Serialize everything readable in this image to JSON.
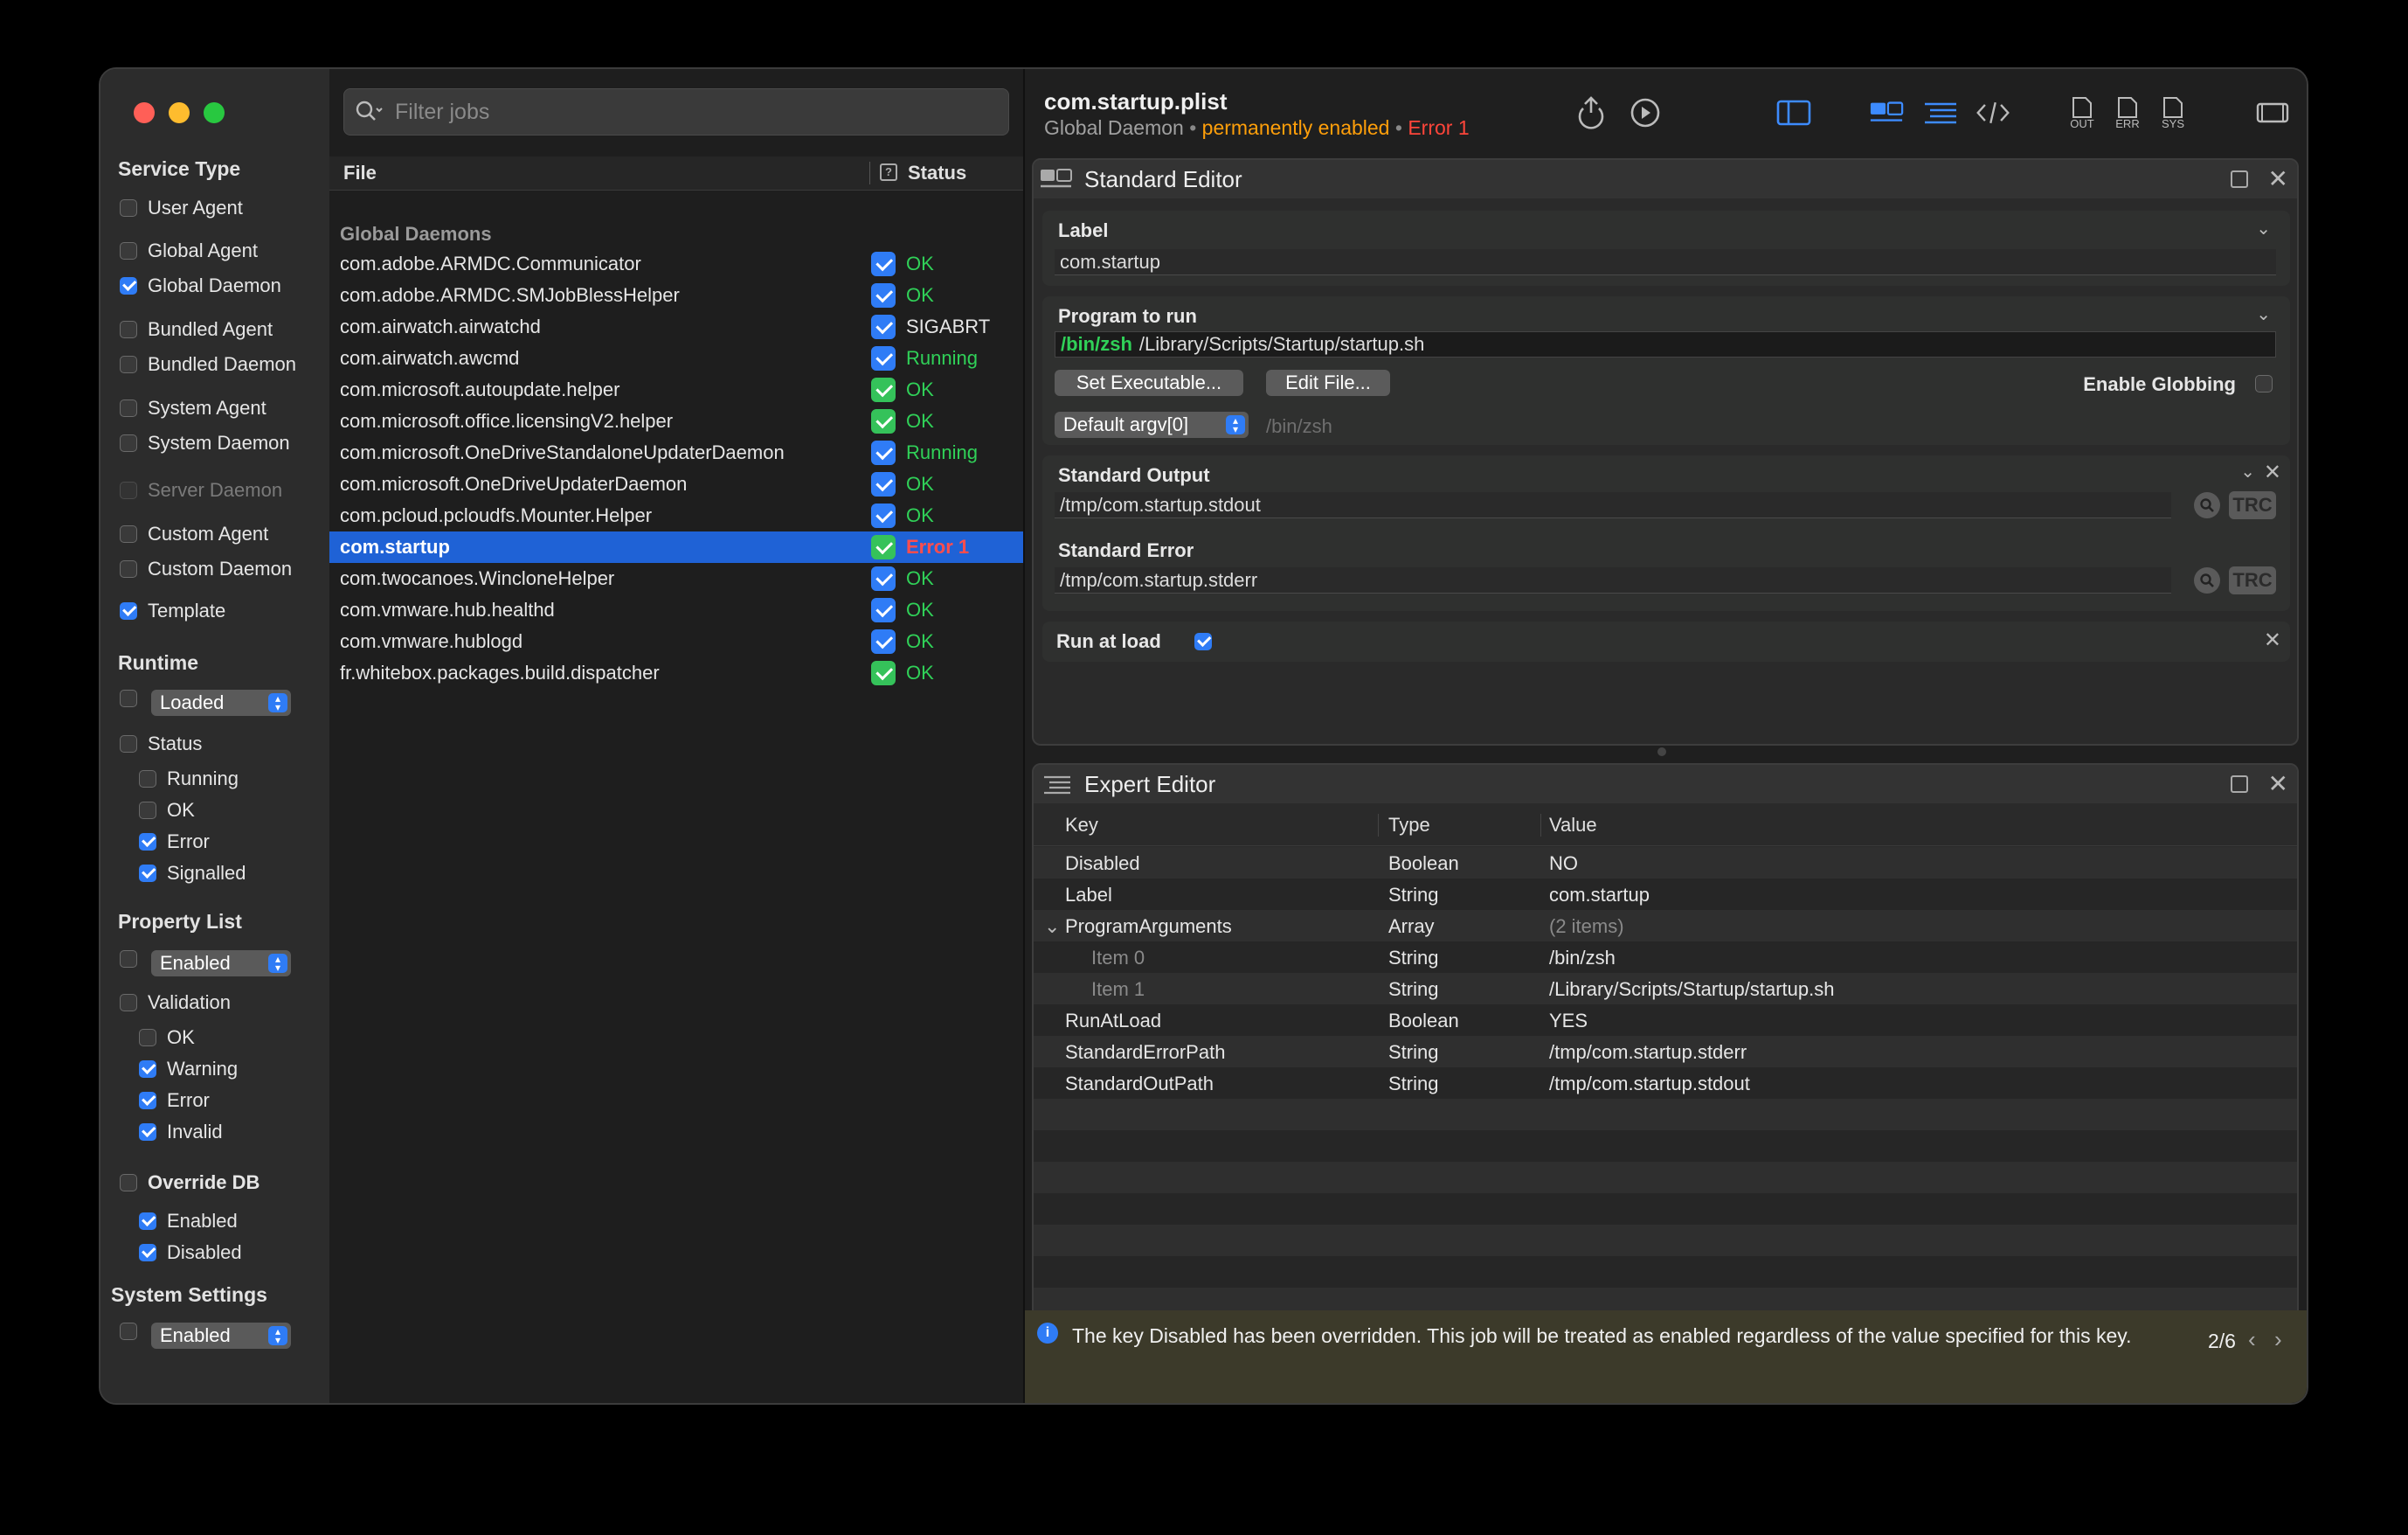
{
  "sidebar": {
    "service_type": "Service Type",
    "user_agent": "User Agent",
    "global_agent": "Global Agent",
    "global_daemon": "Global Daemon",
    "bundled_agent": "Bundled Agent",
    "bundled_daemon": "Bundled Daemon",
    "system_agent": "System Agent",
    "system_daemon": "System Daemon",
    "server_daemon": "Server Daemon",
    "custom_agent": "Custom Agent",
    "custom_daemon": "Custom Daemon",
    "template": "Template",
    "runtime": "Runtime",
    "runtime_popup": "Loaded",
    "status": "Status",
    "running": "Running",
    "ok": "OK",
    "error": "Error",
    "signalled": "Signalled",
    "property_list": "Property List",
    "plist_popup": "Enabled",
    "validation": "Validation",
    "v_ok": "OK",
    "v_warning": "Warning",
    "v_error": "Error",
    "v_invalid": "Invalid",
    "override_db": "Override DB",
    "o_enabled": "Enabled",
    "o_disabled": "Disabled",
    "system_settings": "System Settings",
    "ss_popup": "Enabled"
  },
  "joblist": {
    "filter_placeholder": "Filter jobs",
    "col_file": "File",
    "col_status": "Status",
    "group": "Global Daemons",
    "jobs": [
      {
        "name": "com.adobe.ARMDC.Communicator",
        "status": "OK",
        "color": "#30d158"
      },
      {
        "name": "com.adobe.ARMDC.SMJobBlessHelper",
        "status": "OK",
        "color": "#30d158"
      },
      {
        "name": "com.airwatch.airwatchd",
        "status": "SIGABRT",
        "color": "#e6e6e6"
      },
      {
        "name": "com.airwatch.awcmd",
        "status": "Running",
        "color": "#30d158"
      },
      {
        "name": "com.microsoft.autoupdate.helper",
        "status": "OK",
        "color": "#30d158"
      },
      {
        "name": "com.microsoft.office.licensingV2.helper",
        "status": "OK",
        "color": "#30d158"
      },
      {
        "name": "com.microsoft.OneDriveStandaloneUpdaterDaemon",
        "status": "Running",
        "color": "#30d158"
      },
      {
        "name": "com.microsoft.OneDriveUpdaterDaemon",
        "status": "OK",
        "color": "#30d158"
      },
      {
        "name": "com.pcloud.pcloudfs.Mounter.Helper",
        "status": "OK",
        "color": "#30d158"
      },
      {
        "name": "com.startup",
        "status": "Error 1",
        "color": "#ff4d4d"
      },
      {
        "name": "com.twocanoes.WincloneHelper",
        "status": "OK",
        "color": "#30d158"
      },
      {
        "name": "com.vmware.hub.healthd",
        "status": "OK",
        "color": "#30d158"
      },
      {
        "name": "com.vmware.hublogd",
        "status": "OK",
        "color": "#30d158"
      },
      {
        "name": "fr.whitebox.packages.build.dispatcher",
        "status": "OK",
        "color": "#30d158"
      }
    ]
  },
  "header": {
    "title": "com.startup.plist",
    "type": "Global Daemon",
    "sep": "•",
    "enabled": "permanently enabled",
    "error": "Error 1",
    "out": "OUT",
    "err": "ERR",
    "sys": "SYS"
  },
  "standard_editor": {
    "title": "Standard Editor",
    "label_title": "Label",
    "label_value": "com.startup",
    "program_title": "Program to run",
    "program_exe": "/bin/zsh",
    "program_args": "/Library/Scripts/Startup/startup.sh",
    "set_exec": "Set Executable...",
    "edit_file": "Edit File...",
    "globbing": "Enable Globbing",
    "argv_popup": "Default argv[0]",
    "argv_placeholder": "/bin/zsh",
    "stdout_title": "Standard Output",
    "stdout_value": "/tmp/com.startup.stdout",
    "stderr_title": "Standard Error",
    "stderr_value": "/tmp/com.startup.stderr",
    "trc": "TRC",
    "run_at_load": "Run at load"
  },
  "expert_editor": {
    "title": "Expert Editor",
    "col_key": "Key",
    "col_type": "Type",
    "col_value": "Value",
    "rows": [
      {
        "key": "Disabled",
        "type": "Boolean",
        "value": "NO"
      },
      {
        "key": "Label",
        "type": "String",
        "value": "com.startup"
      },
      {
        "key": "ProgramArguments",
        "type": "Array",
        "value": "(2 items)"
      },
      {
        "key": "Item 0",
        "type": "String",
        "value": "/bin/zsh"
      },
      {
        "key": "Item 1",
        "type": "String",
        "value": "/Library/Scripts/Startup/startup.sh"
      },
      {
        "key": "RunAtLoad",
        "type": "Boolean",
        "value": "YES"
      },
      {
        "key": "StandardErrorPath",
        "type": "String",
        "value": "/tmp/com.startup.stderr"
      },
      {
        "key": "StandardOutPath",
        "type": "String",
        "value": "/tmp/com.startup.stdout"
      }
    ]
  },
  "banner": {
    "message": "The key Disabled has been overridden. This job will be treated as enabled regardless of the value specified for this key.",
    "counter": "2/6"
  }
}
